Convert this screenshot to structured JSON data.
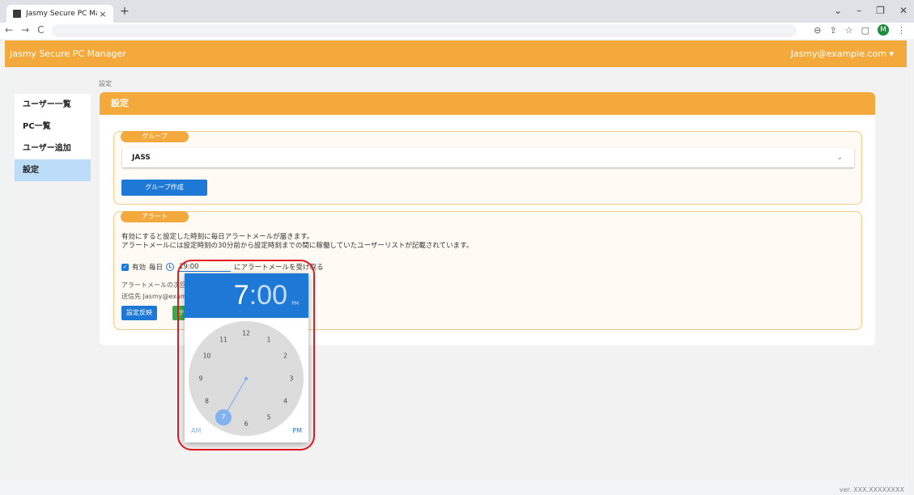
{
  "browser": {
    "tab_title": "Jasmy Secure PC Manager",
    "tab_close": "×",
    "new_tab": "+",
    "window_controls": [
      "⌄",
      "–",
      "❐",
      "✕"
    ],
    "nav": [
      "←",
      "→",
      "C"
    ],
    "toolbar_icons": [
      "⊖",
      "⇪",
      "☆",
      "▢"
    ],
    "profile_initial": "M"
  },
  "app": {
    "brand": "Jasmy Secure PC Manager",
    "user_menu": "Jasmy@example.com ▾",
    "version": "ver. XXX.XXXXXXXX"
  },
  "sidebar": {
    "items": [
      {
        "label": "ユーザー一覧"
      },
      {
        "label": "PC一覧"
      },
      {
        "label": "ユーザー追加"
      },
      {
        "label": "設定"
      }
    ]
  },
  "breadcrumb": "設定",
  "card": {
    "title": "設定",
    "group": {
      "label": "グループ",
      "selected": "JASS",
      "create_button": "グループ作成"
    },
    "alert": {
      "label": "アラート",
      "description_line1": "有効にすると設定した時刻に毎日アラートメールが届きます。",
      "description_line2": "アラートメールには設定時刻の30分前から設定時刻までの間に稼働していたユーザーリストが記載されています。",
      "enabled_label": "有効",
      "daily_label": "毎日",
      "time_value": "19:00",
      "suffix": "にアラートメールを受け取る",
      "info_line1": "アラートメールの次回送",
      "info_line2": "送信先 Jasmy@exampl",
      "apply_button": "設定反映",
      "test_button": "テ"
    }
  },
  "time_picker": {
    "hour": "7",
    "separator": ":",
    "minute": "00",
    "period_indicator": "PM",
    "dial_numbers": [
      "12",
      "1",
      "2",
      "3",
      "4",
      "5",
      "6",
      "7",
      "8",
      "9",
      "10",
      "11"
    ],
    "selected_hour": "7",
    "am_label": "AM",
    "pm_label": "PM"
  }
}
